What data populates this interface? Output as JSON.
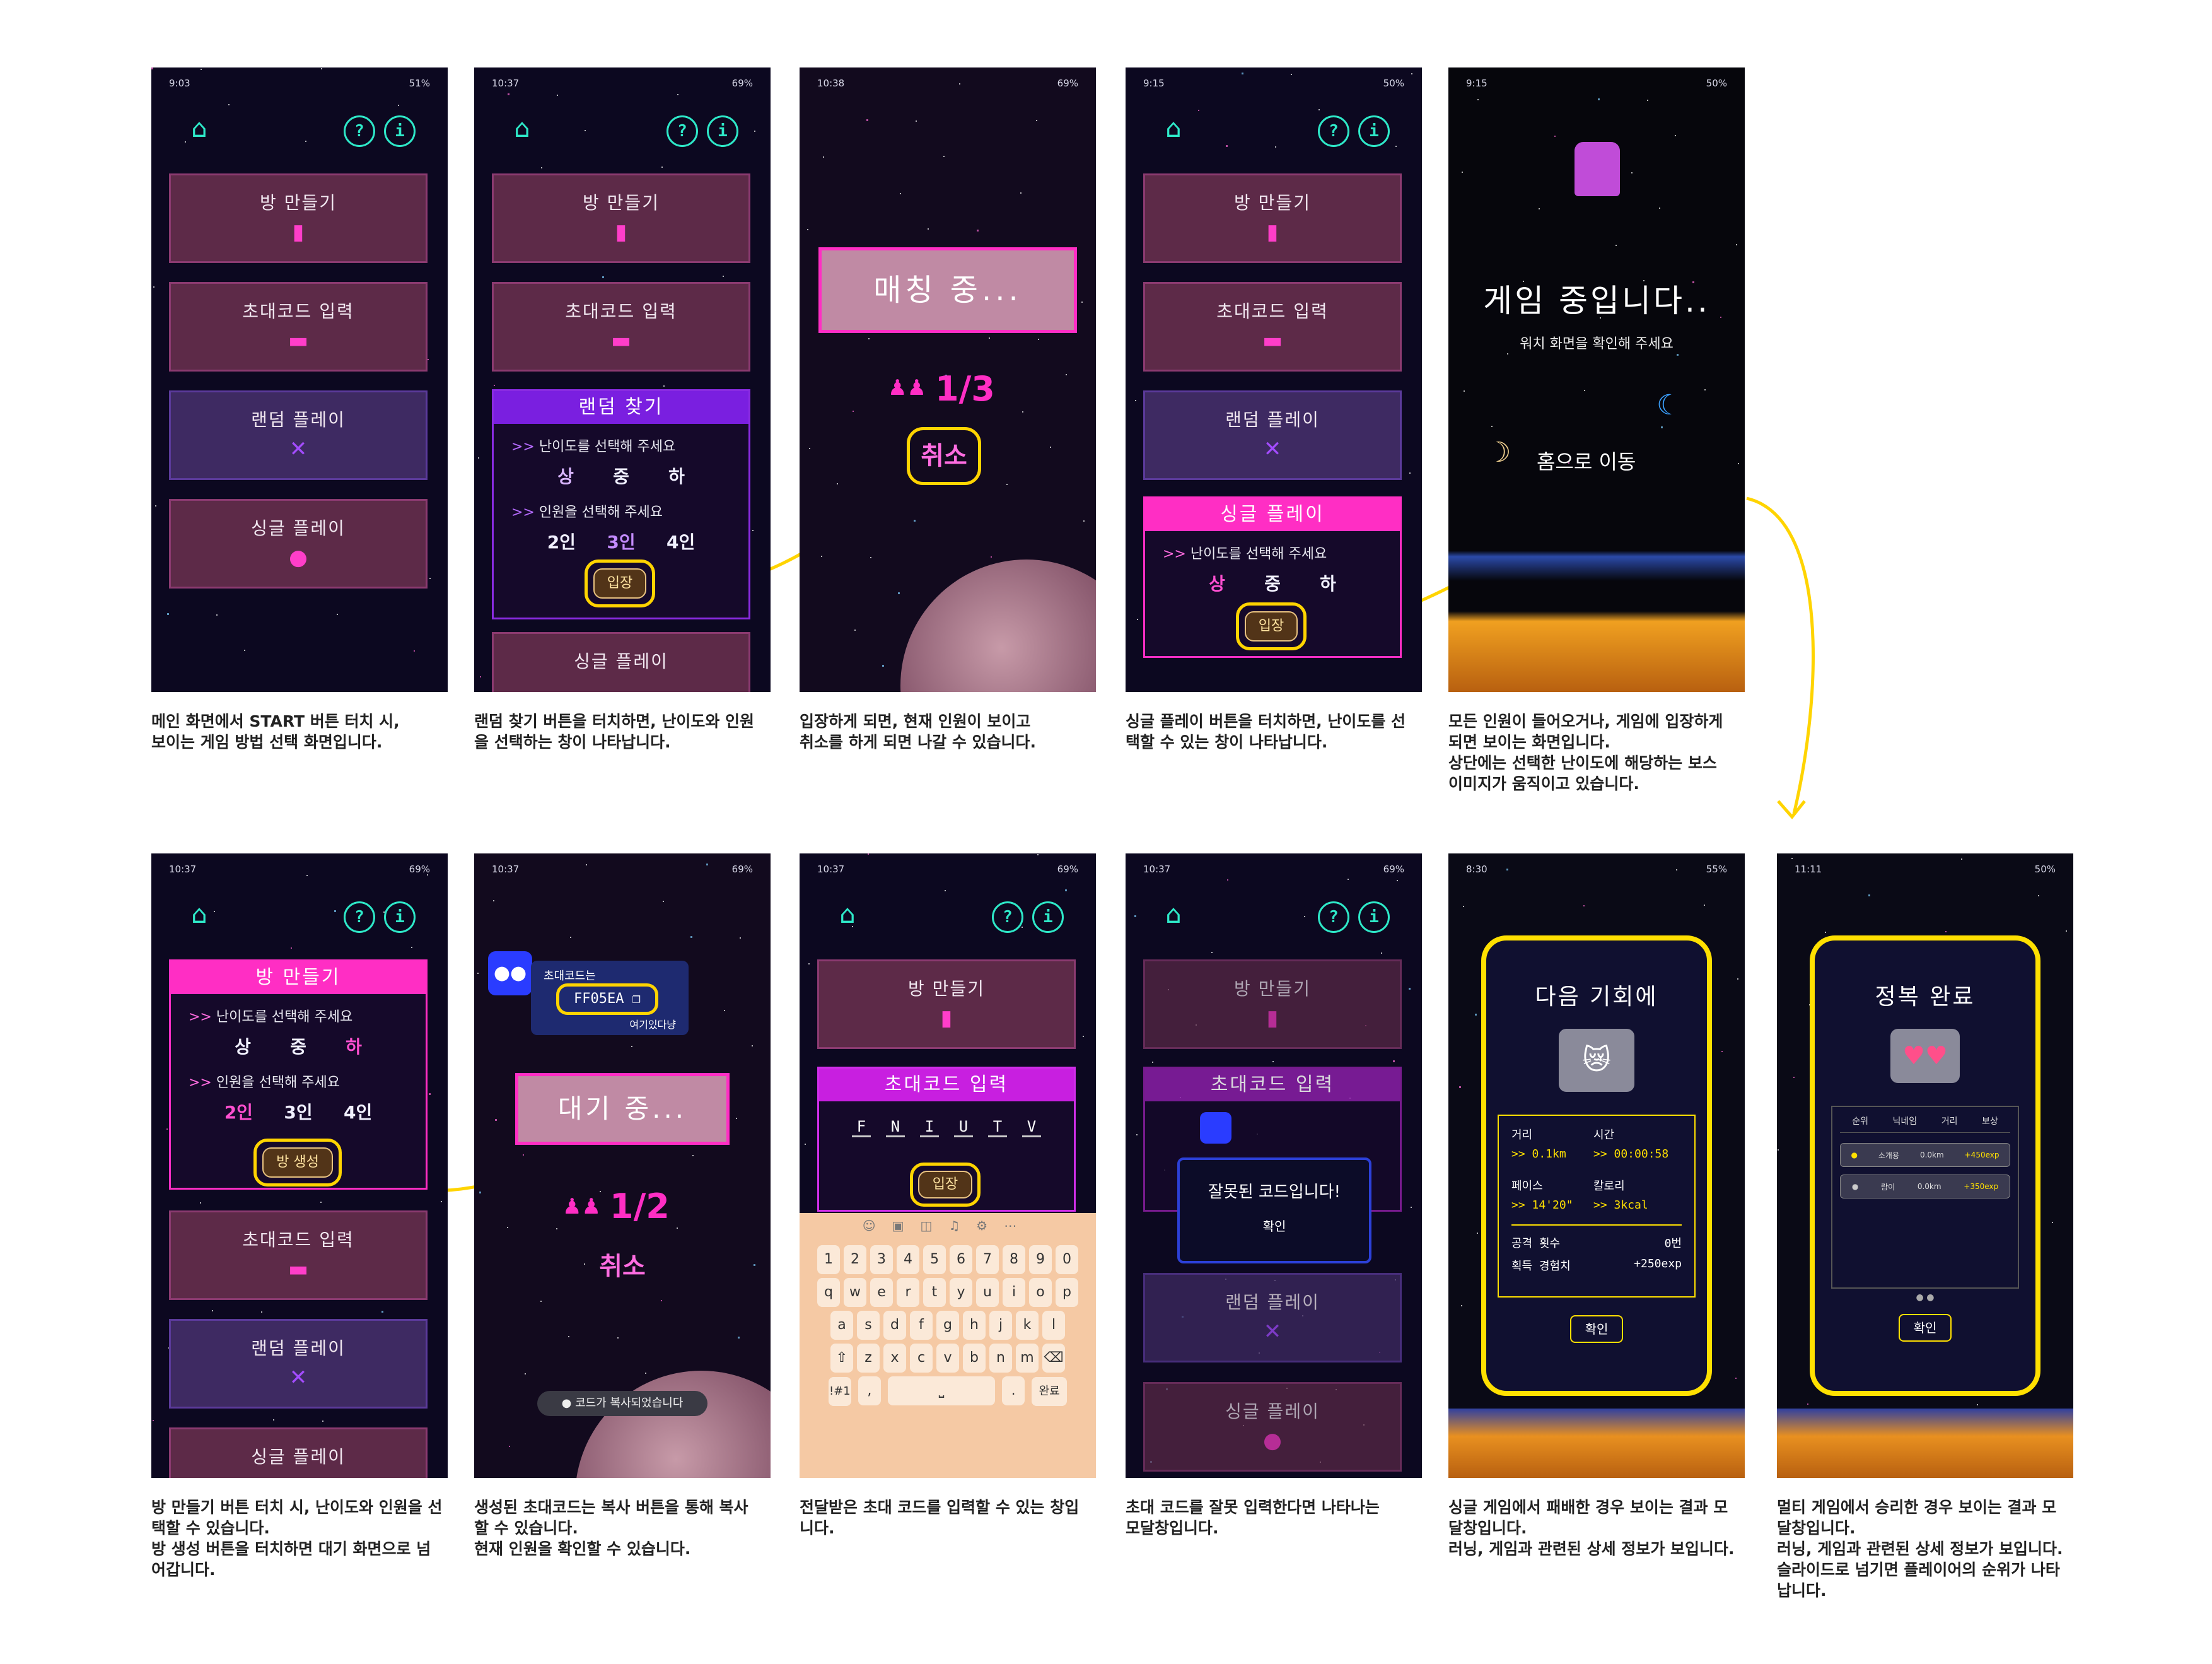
{
  "screens": {
    "s1": {
      "time": "9:03",
      "battery": "51%",
      "menu": [
        "방 만들기",
        "초대코드 입력",
        "랜덤 플레이",
        "싱글 플레이"
      ],
      "caption": "메인 화면에서 START 버튼 터치 시,\n보이는 게임 방법 선택 화면입니다."
    },
    "s2": {
      "time": "10:37",
      "battery": "69%",
      "menu_top": [
        "방 만들기",
        "초대코드 입력"
      ],
      "panel_title": "랜덤 찾기",
      "difficulty_prompt": "난이도를 선택해 주세요",
      "levels": [
        "상",
        "중",
        "하"
      ],
      "people_prompt": "인원을 선택해 주세요",
      "people": [
        "2인",
        "3인",
        "4인"
      ],
      "enter": "입장",
      "menu_bottom": "싱글 플레이",
      "caption": "랜덤 찾기 버튼을 터치하면, 난이도와 인원\n을 선택하는 창이 나타납니다."
    },
    "s3": {
      "time": "10:38",
      "battery": "69%",
      "matching": "매칭 중...",
      "count": "1/3",
      "cancel": "취소",
      "caption": "입장하게 되면, 현재 인원이 보이고\n취소를 하게 되면 나갈 수 있습니다."
    },
    "s4": {
      "time": "9:15",
      "battery": "50%",
      "menu": [
        "방 만들기",
        "초대코드 입력",
        "랜덤 플레이"
      ],
      "panel_title": "싱글 플레이",
      "difficulty_prompt": "난이도를 선택해 주세요",
      "levels": [
        "상",
        "중",
        "하"
      ],
      "enter": "입장",
      "caption": "싱글 플레이 버튼을 터치하면, 난이도를 선\n택할 수 있는 창이 나타납니다."
    },
    "s5": {
      "time": "9:15",
      "battery": "50%",
      "title": "게임 중입니다..",
      "subtitle": "워치 화면을 확인해 주세요",
      "home": "홈으로 이동",
      "caption": "모든 인원이 들어오거나, 게임에 입장하게\n되면 보이는 화면입니다.\n상단에는 선택한 난이도에 해당하는 보스\n이미지가 움직이고 있습니다."
    },
    "s6": {
      "time": "10:37",
      "battery": "69%",
      "panel_title": "방 만들기",
      "difficulty_prompt": "난이도를 선택해 주세요",
      "levels": [
        "상",
        "중",
        "하"
      ],
      "people_prompt": "인원을 선택해 주세요",
      "people": [
        "2인",
        "3인",
        "4인"
      ],
      "create": "방 생성",
      "menu": [
        "초대코드 입력",
        "랜덤 플레이",
        "싱글 플레이"
      ],
      "caption": "방 만들기 버튼 터치 시, 난이도와 인원을 선\n택할 수 있습니다.\n방 생성 버튼을 터치하면 대기 화면으로 넘\n어갑니다."
    },
    "s7": {
      "time": "10:37",
      "battery": "69%",
      "bubble_title": "초대코드는",
      "code": "FF05EA",
      "bubble_sub": "여기있다냥",
      "waiting": "대기 중...",
      "count": "1/2",
      "cancel": "취소",
      "toast": "코드가 복사되었습니다",
      "caption": "생성된 초대코드는 복사 버튼을 통해 복사\n할 수 있습니다.\n현재 인원을 확인할 수 있습니다."
    },
    "s8": {
      "time": "10:37",
      "battery": "69%",
      "menu_top": "방 만들기",
      "panel_title": "초대코드 입력",
      "code_chars": [
        "F",
        "N",
        "I",
        "U",
        "T",
        "V"
      ],
      "enter": "입장",
      "kb_row1": [
        "1",
        "2",
        "3",
        "4",
        "5",
        "6",
        "7",
        "8",
        "9",
        "0"
      ],
      "kb_row2": [
        "q",
        "w",
        "e",
        "r",
        "t",
        "y",
        "u",
        "i",
        "o",
        "p"
      ],
      "kb_row3": [
        "a",
        "s",
        "d",
        "f",
        "g",
        "h",
        "j",
        "k",
        "l"
      ],
      "kb_row4": [
        "z",
        "x",
        "c",
        "v",
        "b",
        "n",
        "m"
      ],
      "kb_sym": "!#1",
      "kb_done": "완료",
      "caption": "전달받은 초대 코드를 입력할 수 있는 창입\n니다."
    },
    "s9": {
      "time": "10:37",
      "battery": "69%",
      "menu_top": "방 만들기",
      "panel_title": "초대코드 입력",
      "modal_text": "잘못된 코드입니다!",
      "modal_ok": "확인",
      "menu": [
        "랜덤 플레이",
        "싱글 플레이"
      ],
      "caption": "초대 코드를 잘못 입력한다면 나타나는\n모달창입니다."
    },
    "s10": {
      "time": "8:30",
      "battery": "55%",
      "title": "다음 기회에",
      "labels": {
        "distance": "거리",
        "time": "시간",
        "pace": "페이스",
        "calorie": "칼로리",
        "attacks": "공격 횟수",
        "exp": "획득 경험치"
      },
      "values": {
        "distance": ">> 0.1km",
        "time": ">> 00:00:58",
        "pace": ">> 14'20\"",
        "calorie": ">> 3kcal",
        "attacks": "0번",
        "exp": "+250exp"
      },
      "ok": "확인",
      "caption": "싱글 게임에서 패배한 경우 보이는 결과 모\n달창입니다.\n러닝, 게임과 관련된 상세 정보가 보입니다."
    },
    "s11": {
      "time": "11:11",
      "battery": "50%",
      "title": "정복 완료",
      "cols": [
        "순위",
        "닉네임",
        "거리",
        "보상"
      ],
      "rows": [
        {
          "name": "소개용",
          "dist": "0.0km",
          "reward": "+450exp"
        },
        {
          "name": "람이",
          "dist": "0.0km",
          "reward": "+350exp"
        }
      ],
      "ok": "확인",
      "caption": "멀티 게임에서 승리한 경우 보이는 결과 모\n달창입니다.\n러닝, 게임과 관련된 상세 정보가 보입니다.\n슬라이드로 넘기면 플레이어의 순위가 나타\n납니다."
    }
  },
  "colors": {
    "bg": "#0c0820",
    "accent_pink": "#ff2ec4",
    "accent_purple": "#8a2be2",
    "yellow": "#ffd400",
    "teal": "#2ee8c8"
  }
}
